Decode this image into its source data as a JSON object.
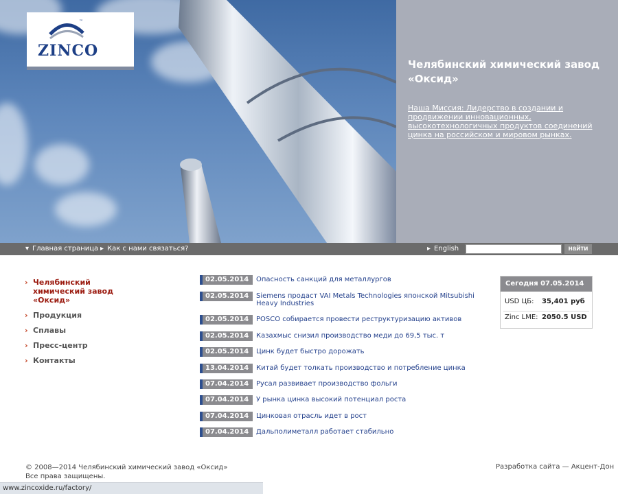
{
  "brand": {
    "logo_text": "ZINCO",
    "trademark": "™"
  },
  "hero": {
    "title": "Челябинский химический завод «Оксид»",
    "mission_link": "Наша Миссия: Лидерство в создании и продвижении инновационных, высокотехнологичных продуктов соединений цинка на российском и мировом рынках."
  },
  "nav": {
    "home": "Главная страница",
    "contact": "Как с нами связаться?",
    "english": "English",
    "search_value": "",
    "search_button": "найти"
  },
  "menu": [
    {
      "label": "Челябинский химический завод «Оксид»",
      "active": true
    },
    {
      "label": "Продукция",
      "active": false
    },
    {
      "label": "Сплавы",
      "active": false
    },
    {
      "label": "Пресс-центр",
      "active": false
    },
    {
      "label": "Контакты",
      "active": false
    }
  ],
  "news": [
    {
      "date": "02.05.2014",
      "title": "Опасность санкций для металлургов"
    },
    {
      "date": "02.05.2014",
      "title": "Siemens продаст VAI Metals Technologies японской Mitsubishi Heavy Industries"
    },
    {
      "date": "02.05.2014",
      "title": "POSCO собирается провести реструктуризацию активов"
    },
    {
      "date": "02.05.2014",
      "title": "Казахмыс снизил производство меди до 69,5 тыс. т"
    },
    {
      "date": "02.05.2014",
      "title": "Цинк будет быстро дорожать"
    },
    {
      "date": "13.04.2014",
      "title": "Китай будет толкать производство и потребление цинка"
    },
    {
      "date": "07.04.2014",
      "title": "Русал развивает производство фольги"
    },
    {
      "date": "07.04.2014",
      "title": "У рынка цинка высокий потенциал роста"
    },
    {
      "date": "07.04.2014",
      "title": "Цинковая отрасль идет в рост"
    },
    {
      "date": "07.04.2014",
      "title": "Дальполиметалл работает стабильно"
    }
  ],
  "rates": {
    "header": "Сегодня 07.05.2014",
    "items": [
      {
        "label": "USD ЦБ:",
        "value": "35,401 руб"
      },
      {
        "label": "Zinc LME:",
        "value": "2050.5 USD"
      }
    ]
  },
  "footer": {
    "copyright": "© 2008—2014 Челябинский химический завод «Оксид»",
    "rights": "Все права защищены.",
    "developer": "Разработка сайта — Акцент-Дон"
  },
  "status_bar": {
    "url": "www.zincoxide.ru/factory/"
  }
}
